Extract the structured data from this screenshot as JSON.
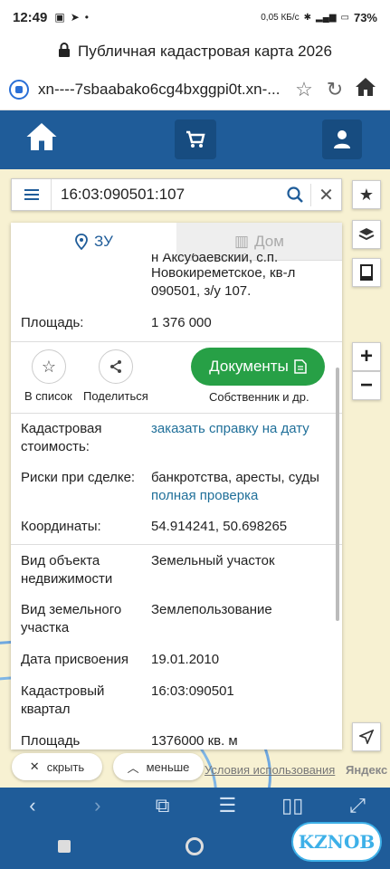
{
  "status": {
    "time": "12:49",
    "battery": "73%",
    "net_speed": "0,05 КБ/с"
  },
  "browser": {
    "page_title": "Публичная кадастровая карта 2026",
    "url": "xn----7sbaabako6cg4bxggpi0t.xn-..."
  },
  "search": {
    "query": "16:03:090501:107"
  },
  "tabs": {
    "parcel": "ЗУ",
    "building": "Дом"
  },
  "address": {
    "line1": "н Аксубаевский, с.п.",
    "line2": "Новокиреметское, кв-л",
    "line3": "090501, з/у 107."
  },
  "area_top": {
    "label": "Площадь:",
    "value": "1 376 000"
  },
  "actions": {
    "add_list": "В список",
    "share": "Поделиться",
    "documents": "Документы",
    "owner": "Собственник и др."
  },
  "details": [
    {
      "label": "Кадастровая стоимость:",
      "value": "заказать справку на дату",
      "link": true
    },
    {
      "label": "Риски при сделке:",
      "value": "банкротства, аресты, суды",
      "value2": "полная проверка"
    },
    {
      "label": "Координаты:",
      "value": "54.914241, 50.698265"
    },
    {
      "label": "Вид объекта недвижимости",
      "value": "Земельный участок"
    },
    {
      "label": "Вид земельного участка",
      "value": "Землепользование"
    },
    {
      "label": "Дата присвоения",
      "value": "19.01.2010"
    },
    {
      "label": "Кадастровый квартал",
      "value": "16:03:090501"
    },
    {
      "label": "Площадь",
      "value": "1376000 кв. м"
    }
  ],
  "map_controls": {
    "hide": "скрыть",
    "less": "меньше",
    "terms": "Условия использования",
    "yandex": "Яндекс",
    "zoom_in": "+",
    "zoom_out": "−"
  },
  "watermark": "KZNOB",
  "colors": {
    "brand": "#1f5c99",
    "documents_button": "#27a046",
    "link": "#1f6f99"
  }
}
